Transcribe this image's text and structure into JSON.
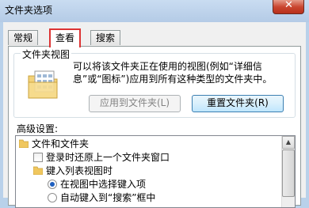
{
  "window": {
    "title": "文件夹选项"
  },
  "tabs": [
    {
      "label": "常规"
    },
    {
      "label": "查看"
    },
    {
      "label": "搜索"
    }
  ],
  "folder_views": {
    "group_title": "文件夹视图",
    "description_line1": "可以将该文件夹正在使用的视图(例如“详细信",
    "description_line2": "息”或“图标”)应用到所有这种类型的文件夹中。",
    "apply_button": "应用到文件夹(L)",
    "reset_button": "重置文件夹(R)"
  },
  "advanced": {
    "label": "高级设置:",
    "items": [
      {
        "text": "文件和文件夹"
      },
      {
        "text": "登录时还原上一个文件夹窗口"
      },
      {
        "text": "键入列表视图时"
      },
      {
        "text": "在视图中选择键入项"
      },
      {
        "text": "自动键入到“搜索”框中"
      }
    ]
  },
  "icons": [
    "close-icon",
    "folder-view-icon",
    "folder-icon",
    "checkbox",
    "radio-selected",
    "radio-unselected",
    "scroll-up-icon"
  ]
}
